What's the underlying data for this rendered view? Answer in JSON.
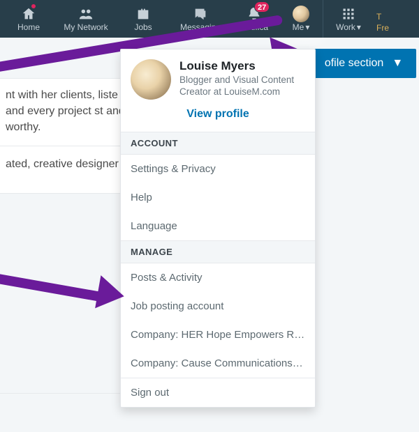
{
  "nav": {
    "home": "Home",
    "network": "My Network",
    "jobs": "Jobs",
    "messaging": "Messaging",
    "notifications": "Notifica",
    "notifications_count": "27",
    "me": "Me",
    "work": "Work",
    "try": "T",
    "try2": "Fre"
  },
  "profile_button": {
    "label": "ofile section"
  },
  "snippet": {
    "top": "nt with her clients, liste each and every project st and trust worthy.",
    "bottom": "ated, creative designer"
  },
  "dropdown": {
    "name": "Louise Myers",
    "headline": "Blogger and Visual Content Creator at LouiseM.com",
    "view_profile": "View profile",
    "account_label": "ACCOUNT",
    "account_items": [
      "Settings & Privacy",
      "Help",
      "Language"
    ],
    "manage_label": "MANAGE",
    "manage_items": [
      "Posts & Activity",
      "Job posting account",
      "Company: HER Hope Empowers Rest…",
      "Company: Cause Communications G…"
    ],
    "sign_out": "Sign out"
  }
}
